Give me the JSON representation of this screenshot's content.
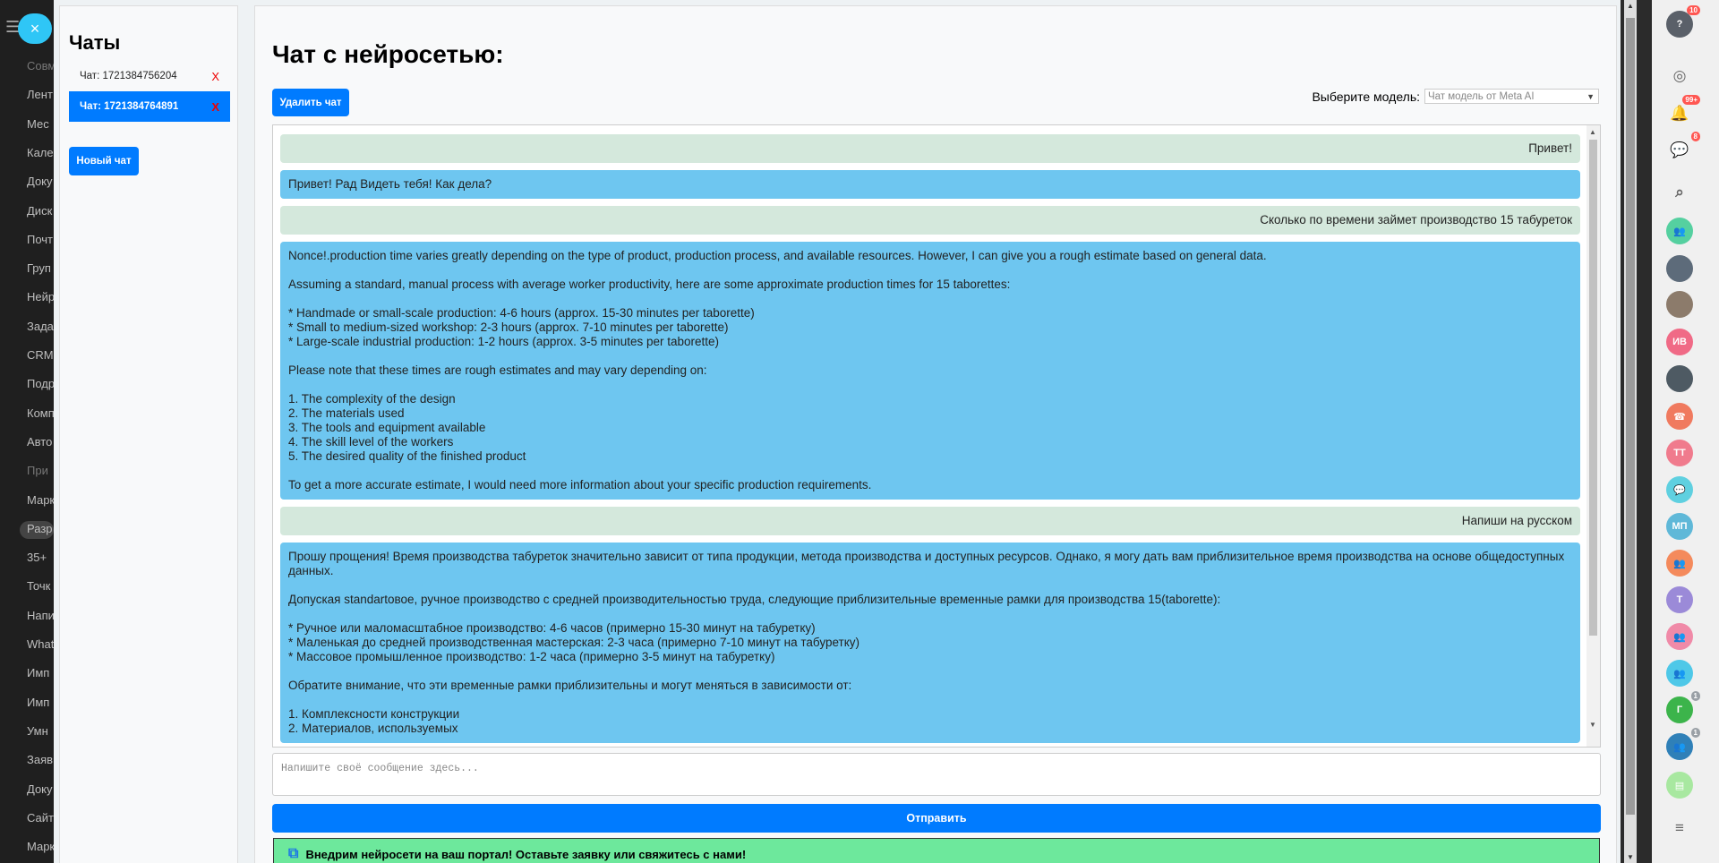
{
  "background_nav": {
    "items": [
      "Совм",
      "Лент",
      "Мес",
      "Кале",
      "Доку",
      "Диск",
      "Почт",
      "Груп",
      "Нейр",
      "Зада",
      "CRM",
      "Подр",
      "Комп",
      "Авто",
      "При",
      "Марк",
      "Разр",
      "35+",
      "Точк",
      "Напи",
      "What",
      "Имп",
      "Имп",
      "Умн",
      "Заяв",
      "Доку",
      "Сайт",
      "Марк"
    ]
  },
  "close_icon": "×",
  "sidebar": {
    "title": "Чаты",
    "chats": [
      {
        "label": "Чат: 1721384756204",
        "delete": "X",
        "active": false
      },
      {
        "label": "Чат: 1721384764891",
        "delete": "X",
        "active": true
      }
    ],
    "new_chat": "Новый чат"
  },
  "main": {
    "title": "Чат с нейросетью:",
    "delete_chat": "Удалить чат",
    "model_label": "Выберите модель:",
    "model_value": "Чат модель от Meta AI",
    "messages": [
      {
        "role": "user",
        "text": "Привет!"
      },
      {
        "role": "bot",
        "text": "Привет! Рад Видеть тебя! Как дела?"
      },
      {
        "role": "user",
        "text": "Сколько по времени займет производство 15 табуреток"
      },
      {
        "role": "bot",
        "text": "Nonce!.production time varies greatly depending on the type of product, production process, and available resources. However, I can give you a rough estimate based on general data.\n\nAssuming a standard, manual process with average worker productivity, here are some approximate production times for 15 taborettes:\n\n* Handmade or small-scale production: 4-6 hours (approx. 15-30 minutes per taborette)\n* Small to medium-sized workshop: 2-3 hours (approx. 7-10 minutes per taborette)\n* Large-scale industrial production: 1-2 hours (approx. 3-5 minutes per taborette)\n\nPlease note that these times are rough estimates and may vary depending on:\n\n1. The complexity of the design\n2. The materials used\n3. The tools and equipment available\n4. The skill level of the workers\n5. The desired quality of the finished product\n\nTo get a more accurate estimate, I would need more information about your specific production requirements."
      },
      {
        "role": "user",
        "text": "Напиши на русском"
      },
      {
        "role": "bot",
        "text": "Прошу прощения! Время производства табуреток значительно зависит от типа продукции, метода производства и доступных ресурсов. Однако, я могу дать вам приблизительное время производства на основе общедоступных данных.\n\nДопуская standartовое, ручное производство с средней производительностью труда, следующие приблизительные временные рамки для производства 15(taborette):\n\n* Ручное или маломасштабное производство: 4-6 часов (примерно 15-30 минут на табуретку)\n* Маленькая до средней производственная мастерская: 2-3 часа (примерно 7-10 минут на табуретку)\n* Массовое промышленное производство: 1-2 часа (примерно 3-5 минут на табуретку)\n\nОбратите внимание, что эти временные рамки приблизительны и могут меняться в зависимости от:\n\n1. Комплексности конструкции\n2. Материалов, используемых"
      }
    ],
    "input_placeholder": "Напишите своё сообщение здесь...",
    "send": "Отправить",
    "promo": "Внедрим нейросети на ваш портал! Оставьте заявку или свяжитесь с нами!"
  },
  "right_bar": {
    "items": [
      {
        "name": "help-icon",
        "glyph": "?",
        "badge": "10",
        "color": "#5a6069"
      },
      {
        "name": "target-icon",
        "glyph": "◎",
        "badge": "",
        "color": ""
      },
      {
        "name": "bell-icon",
        "glyph": "🔔",
        "badge": "99+",
        "color": ""
      },
      {
        "name": "chat-icon",
        "glyph": "💬",
        "badge": "8",
        "color": ""
      },
      {
        "name": "search-icon",
        "glyph": "⌕",
        "badge": "",
        "color": ""
      },
      {
        "name": "group-avatar-icon",
        "glyph": "👥",
        "badge": "",
        "color": "#55d0a0"
      },
      {
        "name": "user-avatar-photo",
        "glyph": "",
        "badge": "",
        "color": "#5d6b7a"
      },
      {
        "name": "user-avatar-photo",
        "glyph": "",
        "badge": "",
        "color": "#8c7b6b"
      },
      {
        "name": "user-avatar-initials",
        "glyph": "ИВ",
        "badge": "",
        "color": "#f06a86"
      },
      {
        "name": "user-avatar-photo",
        "glyph": "",
        "badge": "",
        "color": "#4e5a63"
      },
      {
        "name": "phone-avatar-icon",
        "glyph": "☎",
        "badge": "",
        "color": "#f07a5f"
      },
      {
        "name": "user-avatar-initials",
        "glyph": "ТТ",
        "badge": "",
        "color": "#f07b8d"
      },
      {
        "name": "chat-avatar-icon",
        "glyph": "💬",
        "badge": "",
        "color": "#5fd0e0"
      },
      {
        "name": "user-avatar-initials",
        "glyph": "МП",
        "badge": "",
        "color": "#5fb8d8"
      },
      {
        "name": "group-avatar-icon",
        "glyph": "👥",
        "badge": "",
        "color": "#f48a5c"
      },
      {
        "name": "user-avatar-initials",
        "glyph": "Т",
        "badge": "",
        "color": "#9b8ad8"
      },
      {
        "name": "group-avatar-icon",
        "glyph": "👥",
        "badge": "",
        "color": "#f08aa8"
      },
      {
        "name": "group-avatar-icon",
        "glyph": "👥",
        "badge": "",
        "color": "#4ec8e8"
      },
      {
        "name": "user-avatar-initials",
        "glyph": "Г",
        "badge": "1",
        "color": "#3cb44b"
      },
      {
        "name": "group-avatar-icon",
        "glyph": "👥",
        "badge": "1",
        "color": "#2f80b8"
      },
      {
        "name": "notes-avatar-icon",
        "glyph": "▤",
        "badge": "",
        "color": "#a8e8a0"
      },
      {
        "name": "menu-icon",
        "glyph": "≡",
        "badge": "",
        "color": ""
      }
    ]
  }
}
